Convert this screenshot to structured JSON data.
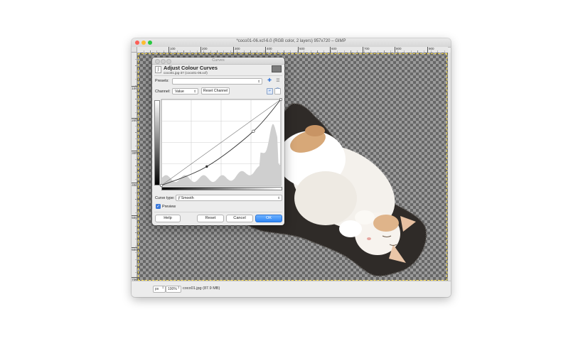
{
  "window": {
    "title": "*coco01-06.xcf-6.0 (RGB color, 2 layers) 957x720 – GIMP"
  },
  "ruler": {
    "x_marks": [
      "100",
      "200",
      "300",
      "400",
      "500",
      "600",
      "700",
      "800",
      "900"
    ],
    "y_marks": [
      "100",
      "200",
      "300",
      "400",
      "500",
      "600",
      "700"
    ]
  },
  "status": {
    "unit": "px",
    "zoom": "100%",
    "text": "coco01.jpg (87.9 MB)"
  },
  "dialog": {
    "title": "Curves",
    "heading": "Adjust Colour Curves",
    "subtitle": "coco01.jpg-37 (coco01-06.xcf)",
    "presets_label": "Presets:",
    "presets_value": "",
    "channel_label": "Channel:",
    "channel_value": "Value",
    "reset_channel": "Reset Channel",
    "curve_type_label": "Curve type:",
    "curve_type_value": "Smooth",
    "preview_label": "Preview",
    "buttons": {
      "help": "Help",
      "reset": "Reset",
      "cancel": "Cancel",
      "ok": "OK"
    }
  },
  "curve_points": [
    [
      0,
      0
    ],
    [
      0.38,
      0.22
    ],
    [
      0.77,
      0.63
    ],
    [
      1,
      1
    ]
  ],
  "colors": {
    "accent": "#2f86f5",
    "checker_dark": "#676767",
    "checker_light": "#9b9b9b"
  }
}
